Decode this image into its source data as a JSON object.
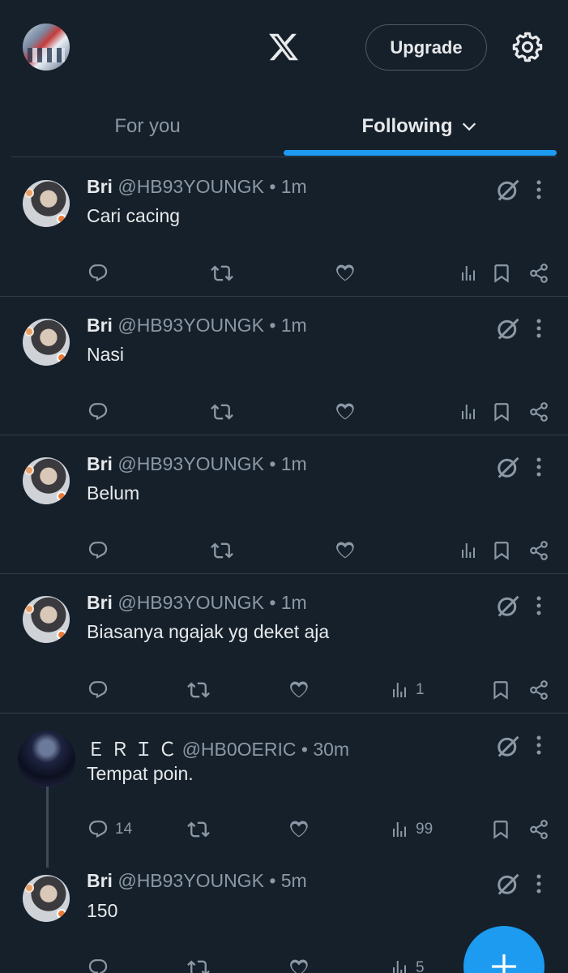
{
  "header": {
    "upgrade_label": "Upgrade",
    "logo_icon": "x-logo-icon",
    "settings_icon": "gear-icon"
  },
  "tabs": [
    {
      "label": "For you",
      "selected": false
    },
    {
      "label": "Following",
      "selected": true
    }
  ],
  "accent_color": "#1d9bf0",
  "tweets": [
    {
      "name": "Bri",
      "handle": "@HB93YOUNGK",
      "time": "• 1m",
      "text": "Cari cacing",
      "replies": "",
      "views": ""
    },
    {
      "name": "Bri",
      "handle": "@HB93YOUNGK",
      "time": "• 1m",
      "text": "Nasi",
      "replies": "",
      "views": ""
    },
    {
      "name": "Bri",
      "handle": "@HB93YOUNGK",
      "time": "• 1m",
      "text": "Belum",
      "replies": "",
      "views": ""
    },
    {
      "name": "Bri",
      "handle": "@HB93YOUNGK",
      "time": "• 1m",
      "text": "Biasanya ngajak yg deket aja",
      "replies": "",
      "views": "1"
    },
    {
      "name": "Ｅ Ｒ Ｉ Ｃ",
      "handle": "@HB0OERIC",
      "time": "• 30m",
      "text": "Tempat poin.",
      "replies": "14",
      "views": "99"
    },
    {
      "name": "Bri",
      "handle": "@HB93YOUNGK",
      "time": "• 5m",
      "text": "150",
      "replies": "",
      "views": "5"
    }
  ]
}
